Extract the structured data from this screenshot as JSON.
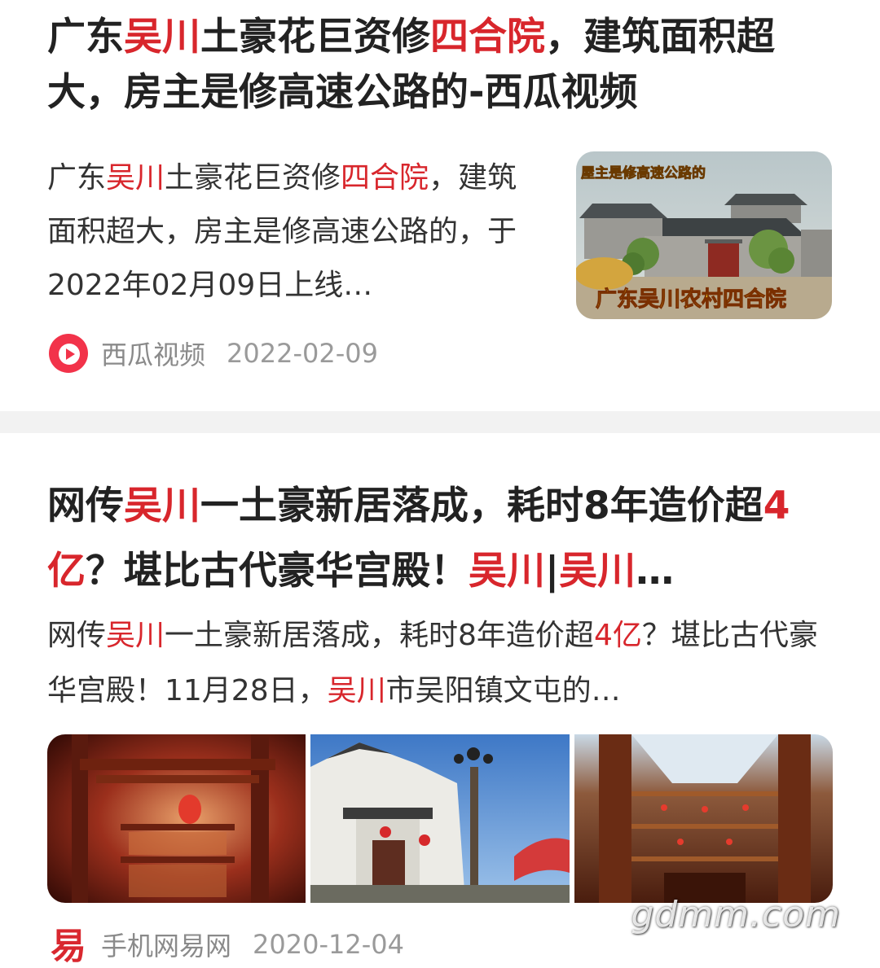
{
  "results": [
    {
      "title": {
        "parts": [
          {
            "text": "广东",
            "hl": false
          },
          {
            "text": "吴川",
            "hl": true
          },
          {
            "text": "土豪花巨资修",
            "hl": false
          },
          {
            "text": "四合院",
            "hl": true
          },
          {
            "text": "，建筑面积超大，房主是修高速公路的-西瓜视频",
            "hl": false
          }
        ]
      },
      "snippet": {
        "parts": [
          {
            "text": "广东",
            "hl": false
          },
          {
            "text": "吴川",
            "hl": true
          },
          {
            "text": "土豪花巨资修",
            "hl": false
          },
          {
            "text": "四合院",
            "hl": true
          },
          {
            "text": "，建筑面积超大，房主是修高速公路的，于2022年02月09日上线…",
            "hl": false
          }
        ]
      },
      "thumbnail": {
        "caption_top": "屋主是修高速公路的",
        "caption_bottom": "广东吴川农村四合院"
      },
      "source": "西瓜视频",
      "source_icon": "xigua-play-icon",
      "date": "2022-02-09"
    },
    {
      "title": {
        "parts": [
          {
            "text": "网传",
            "hl": false
          },
          {
            "text": "吴川",
            "hl": true
          },
          {
            "text": "一土豪新居落成，耗时8年造价超",
            "hl": false
          },
          {
            "text": "4亿",
            "hl": true
          },
          {
            "text": "？堪比古代豪华宫殿！",
            "hl": false
          },
          {
            "text": "吴川",
            "hl": true
          },
          {
            "text": "|",
            "hl": false
          },
          {
            "text": "吴川",
            "hl": true
          },
          {
            "text": "…",
            "hl": false
          }
        ]
      },
      "snippet": {
        "parts": [
          {
            "text": "网传",
            "hl": false
          },
          {
            "text": "吴川",
            "hl": true
          },
          {
            "text": "一土豪新居落成，耗时8年造价超",
            "hl": false
          },
          {
            "text": "4亿",
            "hl": true
          },
          {
            "text": "？堪比古代豪华宫殿！11月28日，",
            "hl": false
          },
          {
            "text": "吴川",
            "hl": true
          },
          {
            "text": "市吴阳镇文屯的…",
            "hl": false
          }
        ]
      },
      "images": [
        "palace-interior-image",
        "white-mansion-exterior-image",
        "atrium-interior-image"
      ],
      "source": "手机网易网",
      "source_icon": "netease-logo-icon",
      "date": "2020-12-04"
    }
  ],
  "watermark": "gdmm.com",
  "colors": {
    "highlight": "#d8262c",
    "title": "#222222",
    "meta": "#8a8a8a",
    "divider": "#f2f2f2"
  }
}
